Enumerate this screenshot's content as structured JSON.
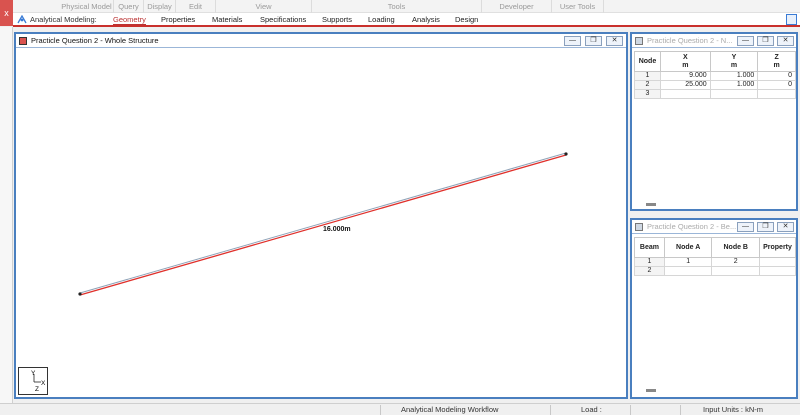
{
  "ribbon_groups": [
    "Physical Model",
    "Query",
    "Display",
    "Edit",
    "View",
    "Tools",
    "Developer",
    "User Tools"
  ],
  "app_mode_label": "Analytical Modeling:",
  "tabs": [
    "Geometry",
    "Properties",
    "Materials",
    "Specifications",
    "Supports",
    "Loading",
    "Analysis",
    "Design"
  ],
  "active_tab": "Geometry",
  "main_window": {
    "title": "Practicle Question 2 - Whole Structure",
    "beam_label": "16.000m",
    "axis_triad": {
      "y": "Y",
      "x": "X",
      "z": "Z"
    }
  },
  "node_window": {
    "title": "Practicle Question 2 - N...",
    "headers": [
      {
        "name": "Node",
        "unit": ""
      },
      {
        "name": "X",
        "unit": "m"
      },
      {
        "name": "Y",
        "unit": "m"
      },
      {
        "name": "Z",
        "unit": "m"
      }
    ],
    "rows": [
      {
        "node": "1",
        "x": "9.000",
        "y": "1.000",
        "z": "0"
      },
      {
        "node": "2",
        "x": "25.000",
        "y": "1.000",
        "z": "0"
      },
      {
        "node": "3",
        "x": "",
        "y": "",
        "z": ""
      }
    ]
  },
  "beam_window": {
    "title": "Practicle Question 2 - Be...",
    "headers": [
      "Beam",
      "Node A",
      "Node B",
      "Property"
    ],
    "rows": [
      {
        "beam": "1",
        "node_a": "1",
        "node_b": "2",
        "property": ""
      },
      {
        "beam": "2",
        "node_a": "",
        "node_b": "",
        "property": ""
      }
    ]
  },
  "window_buttons": {
    "minimize": "—",
    "restore": "❐",
    "close": "✕"
  },
  "status_bar": {
    "workflow": "Analytical Modeling Workflow",
    "load": "Load :",
    "input_units": "Input Units : kN-m"
  },
  "colors": {
    "accent": "#c9302c",
    "window_border": "#4a7fbf",
    "beam": "#e0302b"
  }
}
